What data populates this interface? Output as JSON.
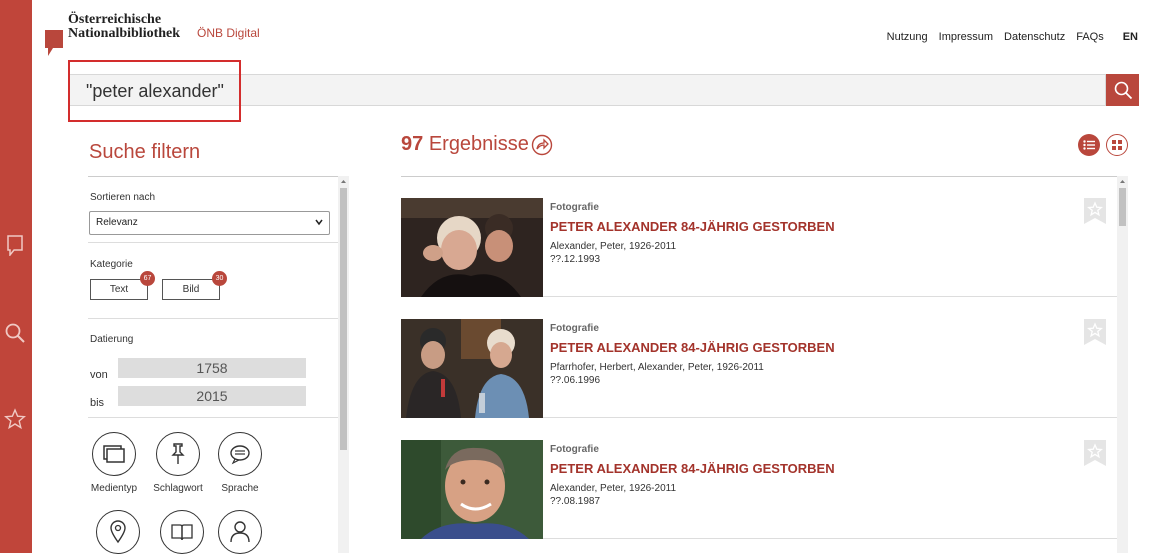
{
  "header": {
    "logo_line1": "Österreichische",
    "logo_line2": "Nationalbibliothek",
    "brand_sub": "ÖNB Digital",
    "nav": [
      "Nutzung",
      "Impressum",
      "Datenschutz",
      "FAQs"
    ],
    "lang": "EN"
  },
  "search": {
    "value": "\"peter alexander\""
  },
  "filter": {
    "title": "Suche filtern",
    "sort_label": "Sortieren nach",
    "sort_value": "Relevanz",
    "category_label": "Kategorie",
    "categories": [
      {
        "label": "Text",
        "count": "67"
      },
      {
        "label": "Bild",
        "count": "30"
      }
    ],
    "date_label": "Datierung",
    "from_label": "von",
    "from_value": "1758",
    "to_label": "bis",
    "to_value": "2015",
    "facets": [
      "Medientyp",
      "Schlagwort",
      "Sprache"
    ]
  },
  "results": {
    "count": "97",
    "label": "Ergebnisse",
    "items": [
      {
        "type": "Fotografie",
        "title": "PETER ALEXANDER 84-JÄHRIG GESTORBEN",
        "persons": "Alexander, Peter, 1926-2011",
        "date": "??.12.1993"
      },
      {
        "type": "Fotografie",
        "title": "PETER ALEXANDER 84-JÄHRIG GESTORBEN",
        "persons": "Pfarrhofer, Herbert, Alexander, Peter, 1926-2011",
        "date": "??.06.1996"
      },
      {
        "type": "Fotografie",
        "title": "PETER ALEXANDER 84-JÄHRIG GESTORBEN",
        "persons": "Alexander, Peter, 1926-2011",
        "date": "??.08.1987"
      }
    ]
  },
  "colors": {
    "brand": "#b9473c",
    "highlight": "#d32d2d"
  },
  "icons": [
    "logo-flag-icon",
    "bookmark-flag-icon",
    "search-icon",
    "star-icon",
    "share-icon",
    "list-view-icon",
    "grid-view-icon",
    "media-type-icon",
    "pin-icon",
    "speech-icon",
    "location-icon",
    "book-icon",
    "person-icon"
  ]
}
